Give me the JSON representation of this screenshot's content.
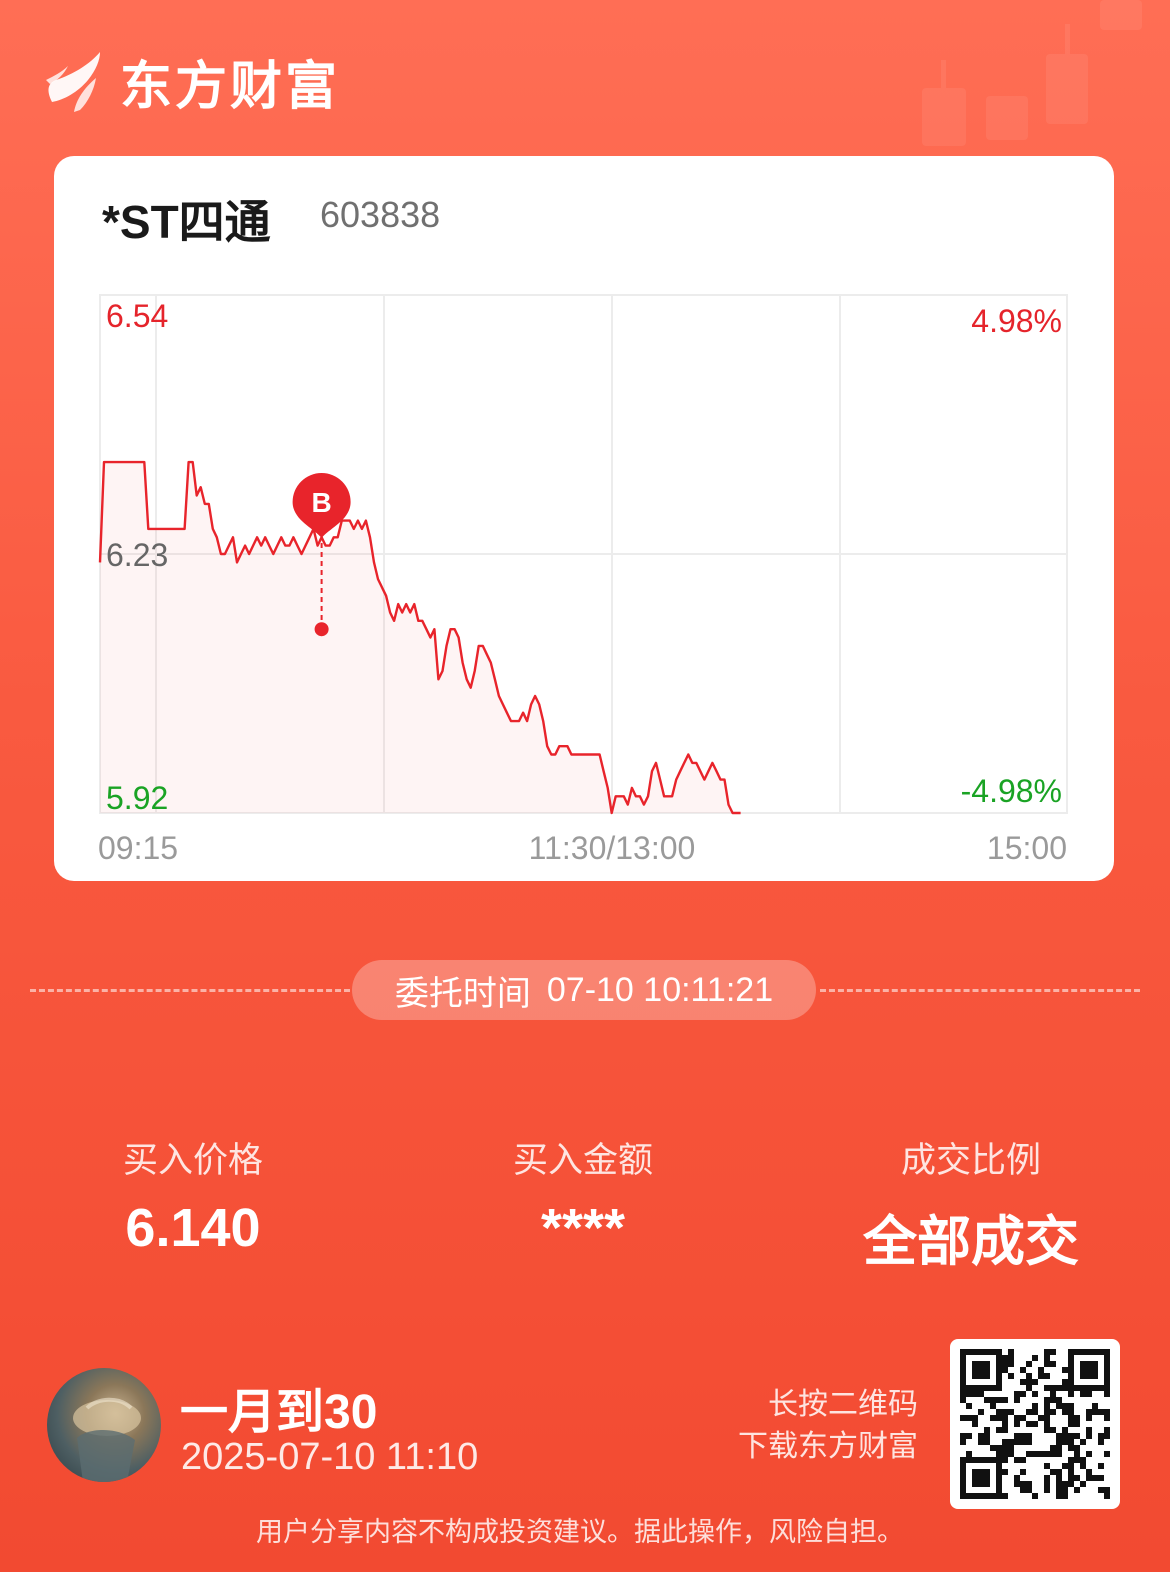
{
  "brand": {
    "name": "东方财富",
    "logo_icon": "eastmoney-leaf-logo-icon"
  },
  "stock": {
    "name": "*ST四通",
    "code": "603838",
    "chart": {
      "price_high": "6.54",
      "price_mid": "6.23",
      "price_low": "5.92",
      "pct_high": "4.98%",
      "pct_low": "-4.98%",
      "time_start": "09:15",
      "time_mid": "11:30/13:00",
      "time_end": "15:00",
      "buy_marker": "B"
    }
  },
  "chart_data": {
    "type": "line",
    "x_label_ticks": [
      "09:15",
      "11:30/13:00",
      "15:00"
    ],
    "ylim": [
      5.92,
      6.54
    ],
    "y_ticks": [
      6.54,
      6.23,
      5.92
    ],
    "percent_ticks": [
      "4.98%",
      "-4.98%"
    ],
    "grid": true,
    "series": [
      {
        "values": [
          6.22,
          6.34,
          6.34,
          6.34,
          6.34,
          6.34,
          6.34,
          6.34,
          6.34,
          6.34,
          6.34,
          6.34,
          6.26,
          6.26,
          6.26,
          6.26,
          6.26,
          6.26,
          6.26,
          6.26,
          6.26,
          6.26,
          6.34,
          6.34,
          6.3,
          6.31,
          6.29,
          6.29,
          6.26,
          6.25,
          6.23,
          6.23,
          6.24,
          6.25,
          6.22,
          6.23,
          6.24,
          6.23,
          6.24,
          6.25,
          6.24,
          6.25,
          6.24,
          6.23,
          6.24,
          6.25,
          6.24,
          6.24,
          6.25,
          6.24,
          6.23,
          6.24,
          6.25,
          6.26,
          6.24,
          6.25,
          6.24,
          6.24,
          6.25,
          6.25,
          6.27,
          6.27,
          6.27,
          6.26,
          6.27,
          6.26,
          6.27,
          6.25,
          6.22,
          6.2,
          6.19,
          6.18,
          6.16,
          6.15,
          6.17,
          6.16,
          6.17,
          6.16,
          6.17,
          6.15,
          6.15,
          6.14,
          6.13,
          6.14,
          6.08,
          6.09,
          6.12,
          6.14,
          6.14,
          6.13,
          6.1,
          6.08,
          6.07,
          6.09,
          6.12,
          6.12,
          6.11,
          6.1,
          6.08,
          6.06,
          6.05,
          6.04,
          6.03,
          6.03,
          6.03,
          6.04,
          6.03,
          6.05,
          6.06,
          6.05,
          6.03,
          6.0,
          5.99,
          5.99,
          6.0,
          6.0,
          6.0,
          5.99,
          5.99,
          5.99,
          5.99,
          5.99,
          5.99,
          5.99,
          5.99,
          5.97,
          5.95,
          5.92,
          5.94,
          5.94,
          5.94,
          5.93,
          5.95,
          5.94,
          5.94,
          5.93,
          5.94,
          5.97,
          5.98,
          5.96,
          5.94,
          5.94,
          5.94,
          5.96,
          5.97,
          5.98,
          5.99,
          5.98,
          5.98,
          5.97,
          5.96,
          5.97,
          5.98,
          5.97,
          5.96,
          5.96,
          5.93,
          5.92,
          5.92,
          5.92
        ],
        "total_points": 241
      }
    ],
    "buy_marker": {
      "label": "B",
      "index": 55,
      "price": 6.14
    }
  },
  "order": {
    "label": "委托时间",
    "datetime": "07-10 10:11:21"
  },
  "stats": [
    {
      "label": "买入价格",
      "value": "6.140"
    },
    {
      "label": "买入金额",
      "value": "****"
    },
    {
      "label": "成交比例",
      "value": "全部成交"
    }
  ],
  "user": {
    "name": "一月到30",
    "time": "2025-07-10 11:10",
    "avatar_icon": "user-avatar-icon"
  },
  "qr": {
    "hint_line1": "长按二维码",
    "hint_line2": "下载东方财富",
    "icon": "qr-code-icon"
  },
  "disclaimer": "用户分享内容不构成投资建议。据此操作，风险自担。",
  "colors": {
    "up": "#e5242b",
    "down": "#1aa324",
    "neutral": "#666666",
    "line": "#e8242b",
    "background": "#f75a40"
  }
}
